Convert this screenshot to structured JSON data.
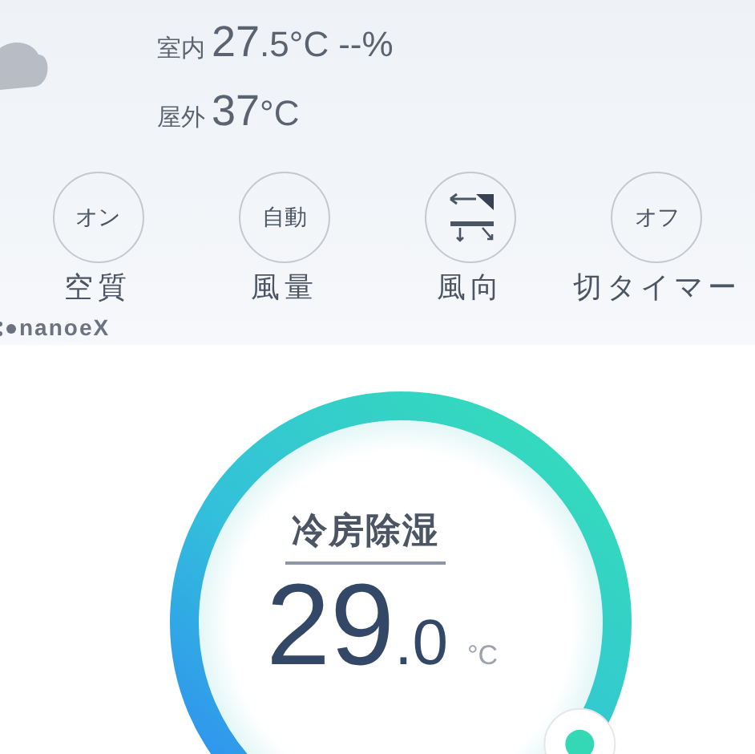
{
  "climate": {
    "indoor": {
      "label": "室内",
      "temp_main": "27",
      "temp_rest": ".5°C",
      "humidity": "--%"
    },
    "outdoor": {
      "label": "屋外",
      "temp_main": "37",
      "temp_rest": "°C"
    }
  },
  "controls": [
    {
      "kind": "text",
      "value": "オン",
      "label": "空質"
    },
    {
      "kind": "text",
      "value": "自動",
      "label": "風量"
    },
    {
      "kind": "airflow",
      "label": "風向"
    },
    {
      "kind": "text",
      "value": "オフ",
      "label": "切タイマー"
    }
  ],
  "logo": "nanoeX",
  "dial": {
    "mode": "冷房除湿",
    "temp_main": "29",
    "temp_rest": ".0",
    "unit": "°C",
    "level": 0.96
  }
}
